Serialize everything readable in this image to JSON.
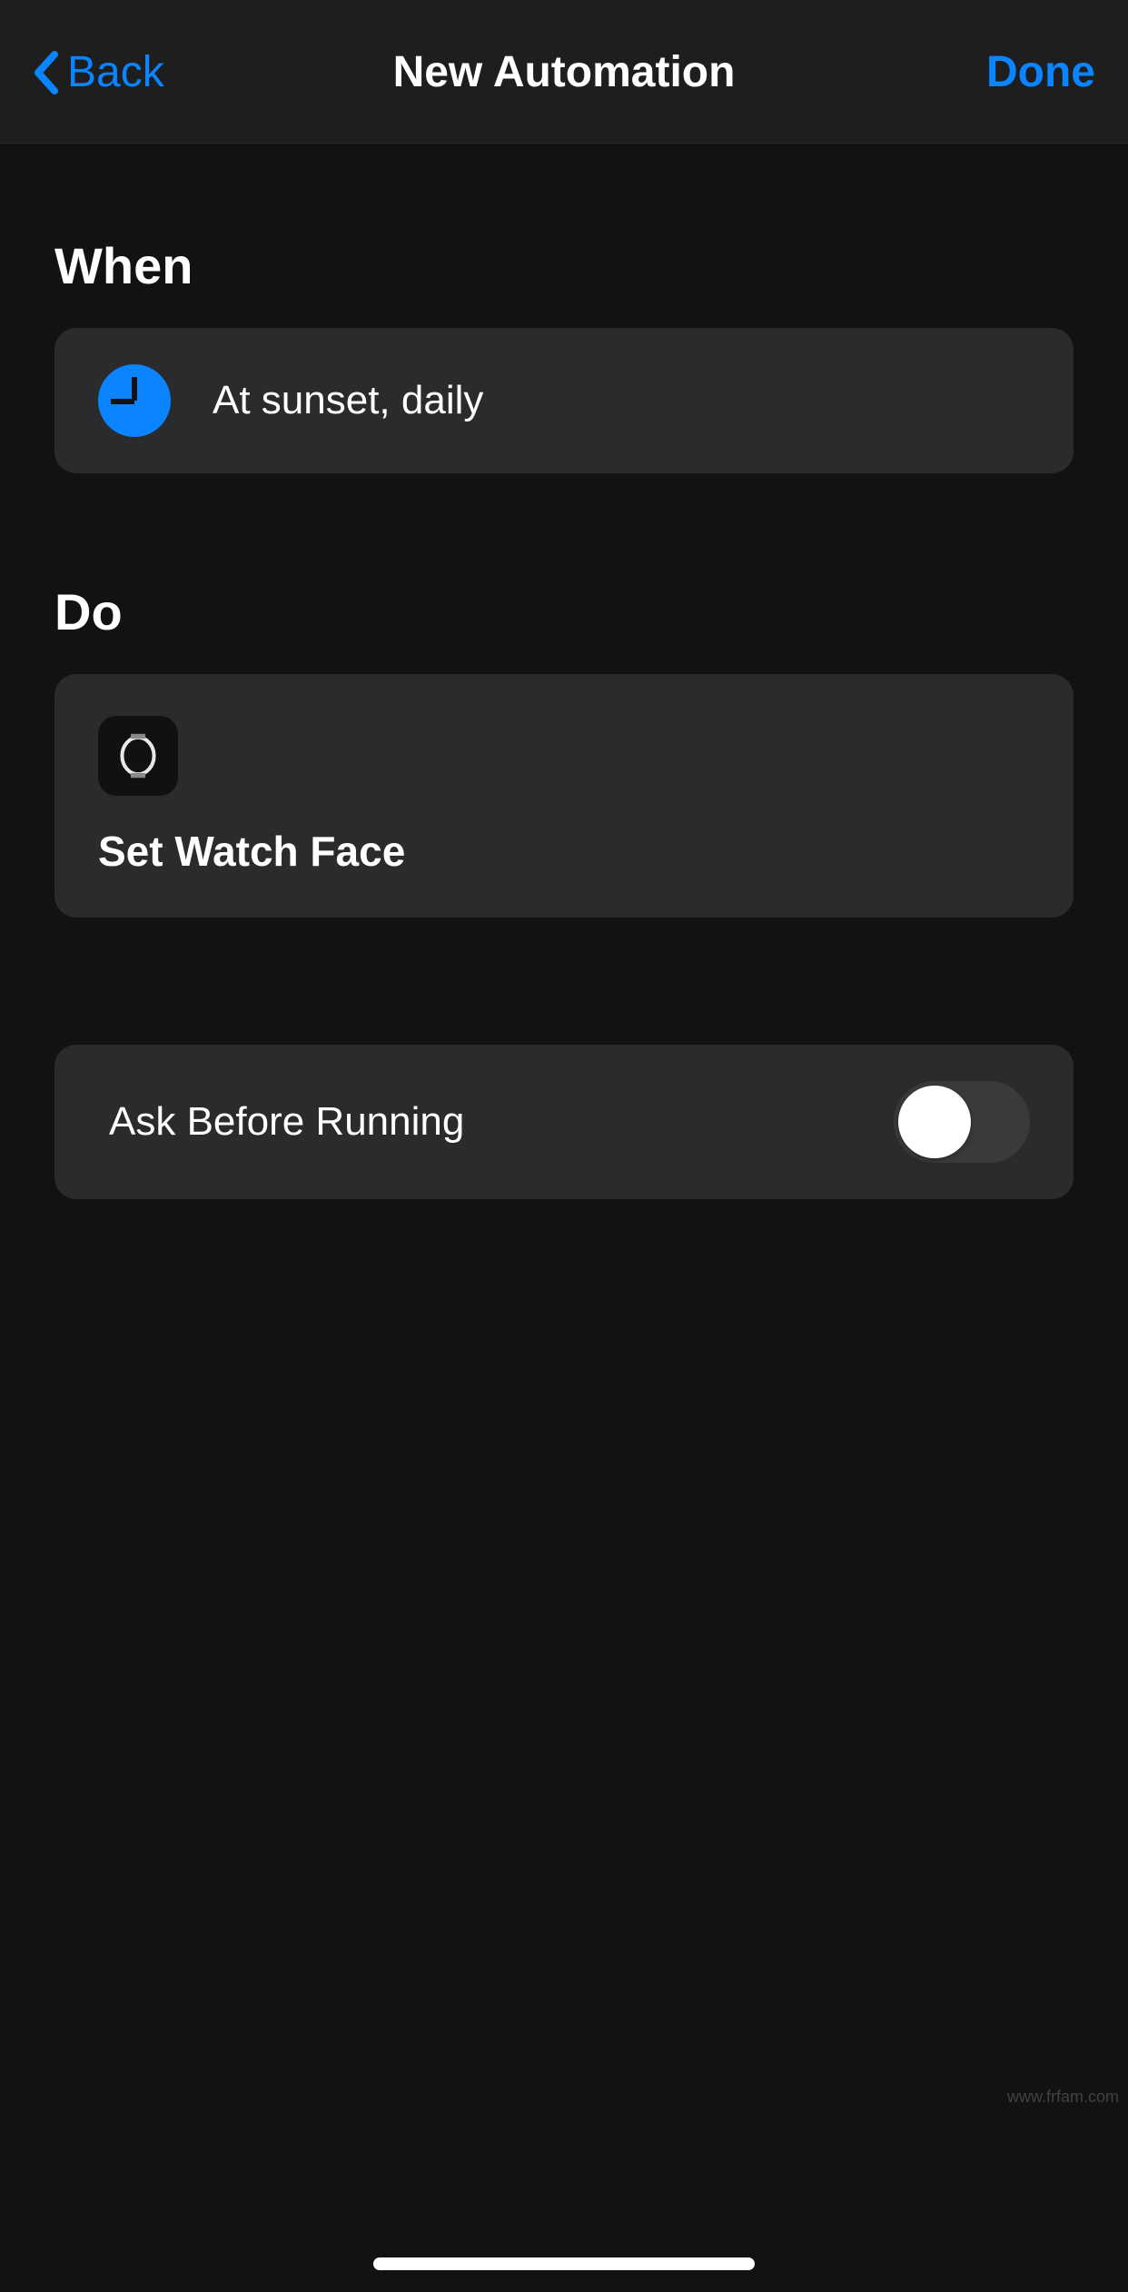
{
  "nav": {
    "back_label": "Back",
    "title": "New Automation",
    "done_label": "Done"
  },
  "sections": {
    "when_header": "When",
    "do_header": "Do"
  },
  "when": {
    "trigger_label": "At sunset, daily"
  },
  "do": {
    "action_title": "Set Watch Face"
  },
  "settings": {
    "ask_before_running_label": "Ask Before Running",
    "ask_before_running_state": false
  },
  "watermark": "www.frfam.com"
}
